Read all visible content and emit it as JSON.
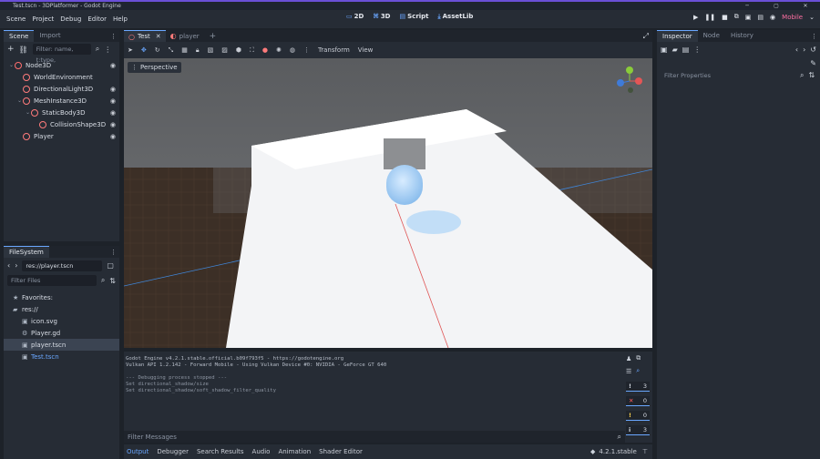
{
  "window": {
    "title": "Test.tscn - 3DPlatformer - Godot Engine"
  },
  "menu": [
    "Scene",
    "Project",
    "Debug",
    "Editor",
    "Help"
  ],
  "modes": [
    {
      "icon": "▭",
      "label": "2D"
    },
    {
      "icon": "⌘",
      "label": "3D"
    },
    {
      "icon": "▤",
      "label": "Script"
    },
    {
      "icon": "⤓",
      "label": "AssetLib"
    }
  ],
  "renderer": "Mobile",
  "scene_dock": {
    "tabs": [
      "Scene",
      "Import"
    ],
    "filter_placeholder": "Filter: name, t:type, ",
    "nodes": [
      {
        "label": "Node3D",
        "color": "#ff6f6f",
        "indent": 0,
        "eye": true
      },
      {
        "label": "WorldEnvironment",
        "color": "#ff7b7b",
        "indent": 1,
        "eye": false
      },
      {
        "label": "DirectionalLight3D",
        "color": "#ff7b7b",
        "indent": 1,
        "eye": true
      },
      {
        "label": "MeshInstance3D",
        "color": "#ff7b7b",
        "indent": 1,
        "eye": true
      },
      {
        "label": "StaticBody3D",
        "color": "#ff7b7b",
        "indent": 2,
        "eye": true
      },
      {
        "label": "CollisionShape3D",
        "color": "#ff7b7b",
        "indent": 3,
        "eye": true
      },
      {
        "label": "Player",
        "color": "#ff7b7b",
        "indent": 1,
        "eye": true
      }
    ]
  },
  "filesystem": {
    "title": "FileSystem",
    "path": "res://player.tscn",
    "filter_placeholder": "Filter Files",
    "items": [
      {
        "label": "Favorites:",
        "icon": "★",
        "indent": 0,
        "selected": false,
        "color": "#d8dde5"
      },
      {
        "label": "res://",
        "icon": "▰",
        "indent": 0,
        "selected": false,
        "color": "#d8dde5"
      },
      {
        "label": "icon.svg",
        "icon": "▣",
        "indent": 1,
        "selected": false,
        "color": "#d8dde5"
      },
      {
        "label": "Player.gd",
        "icon": "⚙",
        "indent": 1,
        "selected": false,
        "color": "#d8dde5"
      },
      {
        "label": "player.tscn",
        "icon": "▣",
        "indent": 1,
        "selected": true,
        "color": "#d8dde5"
      },
      {
        "label": "Test.tscn",
        "icon": "▣",
        "indent": 1,
        "selected": false,
        "color": "#6aa7ff"
      }
    ]
  },
  "editor_tabs": [
    "Test",
    "player"
  ],
  "viewport": {
    "toolbar_labels": [
      "Transform",
      "View"
    ],
    "perspective_label": "Perspective"
  },
  "inspector": {
    "tabs": [
      "Inspector",
      "Node",
      "History"
    ],
    "filter_placeholder": "Filter Properties"
  },
  "output": {
    "lines": [
      "Godot Engine v4.2.1.stable.official.b09f793f5 - https://godotengine.org",
      "Vulkan API 1.2.142 - Forward Mobile - Using Vulkan Device #0: NVIDIA - GeForce GT 640",
      "",
      "--- Debugging process stopped ---",
      "Set directional_shadow/size",
      "Set directional_shadow/soft_shadow_filter_quality"
    ],
    "filter_placeholder": "Filter Messages",
    "badges": [
      {
        "icon": "!",
        "count": "3",
        "color": "#d8dde5"
      },
      {
        "icon": "✕",
        "count": "0",
        "color": "#ff5d5d"
      },
      {
        "icon": "!",
        "count": "0",
        "color": "#ffd24d"
      },
      {
        "icon": "i",
        "count": "3",
        "color": "#d8dde5"
      }
    ]
  },
  "bottom_tabs": [
    "Output",
    "Debugger",
    "Search Results",
    "Audio",
    "Animation",
    "Shader Editor"
  ],
  "version": "4.2.1.stable"
}
